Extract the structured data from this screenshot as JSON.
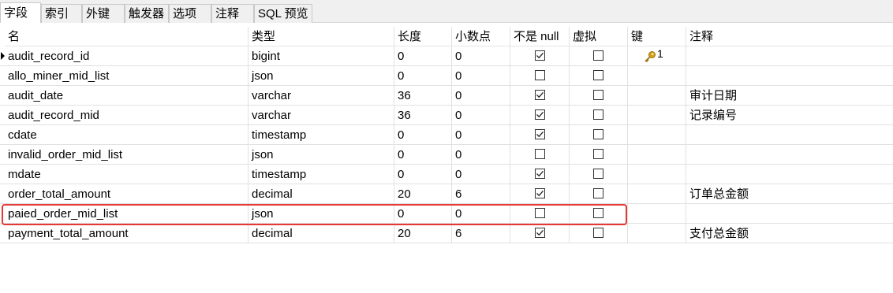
{
  "tabs": [
    "字段",
    "索引",
    "外键",
    "触发器",
    "选项",
    "注释",
    "SQL 预览"
  ],
  "columns": {
    "name": "名",
    "type": "类型",
    "length": "长度",
    "decimals": "小数点",
    "not_null": "不是 null",
    "virtual": "虚拟",
    "key": "键",
    "comment": "注释"
  },
  "rows": [
    {
      "name": "audit_record_id",
      "type": "bigint",
      "length": "0",
      "decimals": "0",
      "not_null": true,
      "virtual": false,
      "key": "1",
      "comment": ""
    },
    {
      "name": "allo_miner_mid_list",
      "type": "json",
      "length": "0",
      "decimals": "0",
      "not_null": false,
      "virtual": false,
      "key": "",
      "comment": ""
    },
    {
      "name": "audit_date",
      "type": "varchar",
      "length": "36",
      "decimals": "0",
      "not_null": true,
      "virtual": false,
      "key": "",
      "comment": "审计日期"
    },
    {
      "name": "audit_record_mid",
      "type": "varchar",
      "length": "36",
      "decimals": "0",
      "not_null": true,
      "virtual": false,
      "key": "",
      "comment": "记录编号"
    },
    {
      "name": "cdate",
      "type": "timestamp",
      "length": "0",
      "decimals": "0",
      "not_null": true,
      "virtual": false,
      "key": "",
      "comment": ""
    },
    {
      "name": "invalid_order_mid_list",
      "type": "json",
      "length": "0",
      "decimals": "0",
      "not_null": false,
      "virtual": false,
      "key": "",
      "comment": ""
    },
    {
      "name": "mdate",
      "type": "timestamp",
      "length": "0",
      "decimals": "0",
      "not_null": true,
      "virtual": false,
      "key": "",
      "comment": ""
    },
    {
      "name": "order_total_amount",
      "type": "decimal",
      "length": "20",
      "decimals": "6",
      "not_null": true,
      "virtual": false,
      "key": "",
      "comment": "订单总金额"
    },
    {
      "name": "paied_order_mid_list",
      "type": "json",
      "length": "0",
      "decimals": "0",
      "not_null": false,
      "virtual": false,
      "key": "",
      "comment": ""
    },
    {
      "name": "payment_total_amount",
      "type": "decimal",
      "length": "20",
      "decimals": "6",
      "not_null": true,
      "virtual": false,
      "key": "",
      "comment": "支付总金额"
    }
  ],
  "current_row_index": 0,
  "highlighted_row_index": 8,
  "highlight_color": "#e53935",
  "key_icon": "key-icon",
  "key_icon_color": "#d4a017"
}
